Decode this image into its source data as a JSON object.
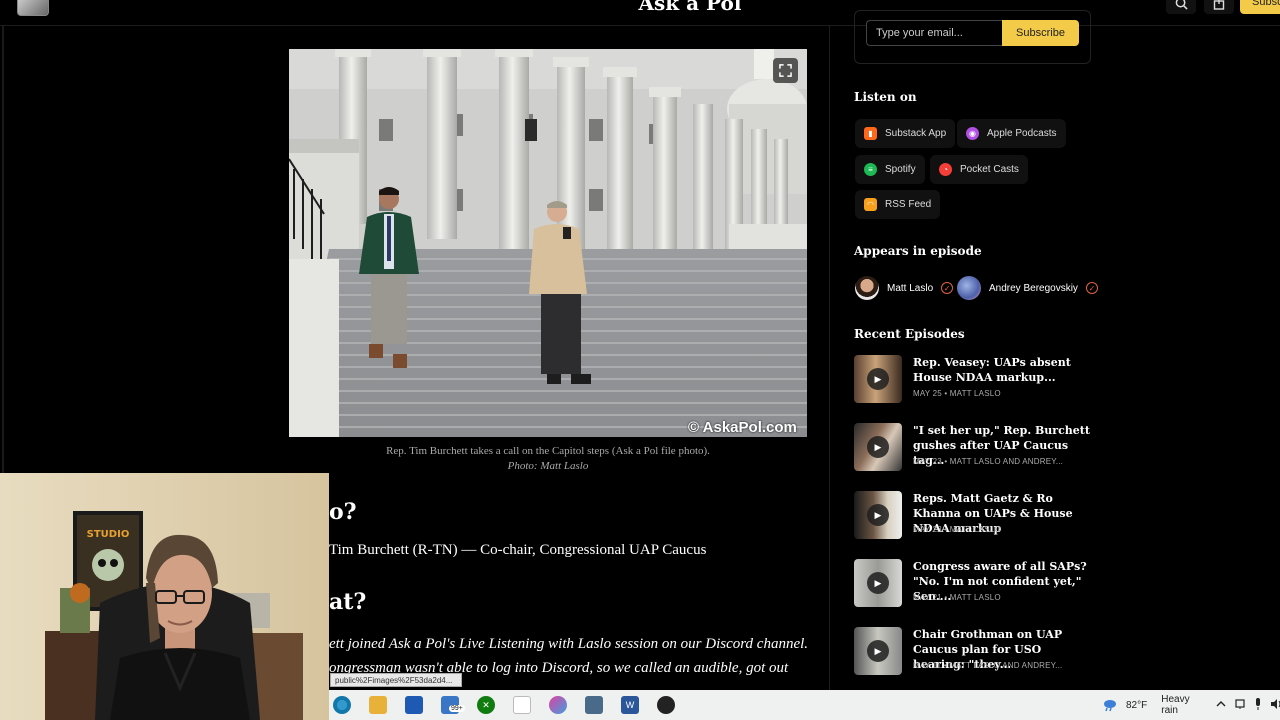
{
  "header": {
    "site_title": "Ask a Pol",
    "subscribe_label": "Subsc"
  },
  "article": {
    "image_watermark": "© AskaPol.com",
    "caption": "Rep. Tim Burchett takes a call on the Capitol steps (Ask a Pol file photo).",
    "photo_credit": "Photo: Matt Laslo",
    "heading_who": "o?",
    "who_line": "Tim Burchett (R-TN) — Co-chair, Congressional UAP Caucus",
    "heading_what": "at?",
    "body_line1": "ett joined Ask a Pol's Live Listening with Laslo session on our Discord channel.",
    "body_line2": "ongressman wasn't able to log into Discord, so we called an audible, got out"
  },
  "sidebar": {
    "email_placeholder": "Type your email...",
    "subscribe_button": "Subscribe",
    "listen_on_heading": "Listen on",
    "platforms": [
      {
        "label": "Substack App",
        "color": "#ff6719",
        "icon": "bookmark-icon"
      },
      {
        "label": "Apple Podcasts",
        "color": "#b150e2",
        "icon": "podcast-icon"
      },
      {
        "label": "Spotify",
        "color": "#1db954",
        "icon": "spotify-icon"
      },
      {
        "label": "Pocket Casts",
        "color": "#f43e37",
        "icon": "pocketcasts-icon"
      },
      {
        "label": "RSS Feed",
        "color": "#f7a01c",
        "icon": "rss-icon"
      }
    ],
    "appears_heading": "Appears in episode",
    "people": [
      {
        "name": "Matt Laslo"
      },
      {
        "name": "Andrey Beregovskiy"
      }
    ],
    "recent_heading": "Recent Episodes",
    "episodes": [
      {
        "title": "Rep. Veasey: UAPs absent House NDAA markup...",
        "meta": "MAY 25 • MATT LASLO"
      },
      {
        "title": "\"I set her up,\" Rep. Burchett gushes after UAP Caucus tag...",
        "meta": "MAY 23 • MATT LASLO AND ANDREY..."
      },
      {
        "title": "Reps. Matt Gaetz & Ro Khanna on UAPs & House NDAA markup",
        "meta": "MAY 23 • MATT LASLO"
      },
      {
        "title": "Congress aware of all SAPs? \"No. I'm not confident yet,\" Sen....",
        "meta": "MAY 21 • MATT LASLO"
      },
      {
        "title": "Chair Grothman on UAP Caucus plan for USO hearing: \"they...",
        "meta": "MAY 11 • MATT LASLO AND ANDREY..."
      }
    ]
  },
  "status_tooltip": "public%2Fimages%2F53da2d4...",
  "taskbar": {
    "mail_badge": "99+",
    "temperature": "82°F",
    "weather": "Heavy rain"
  },
  "colors": {
    "accent": "#f3cb48",
    "background": "#000000",
    "verified": "#e0633c"
  }
}
